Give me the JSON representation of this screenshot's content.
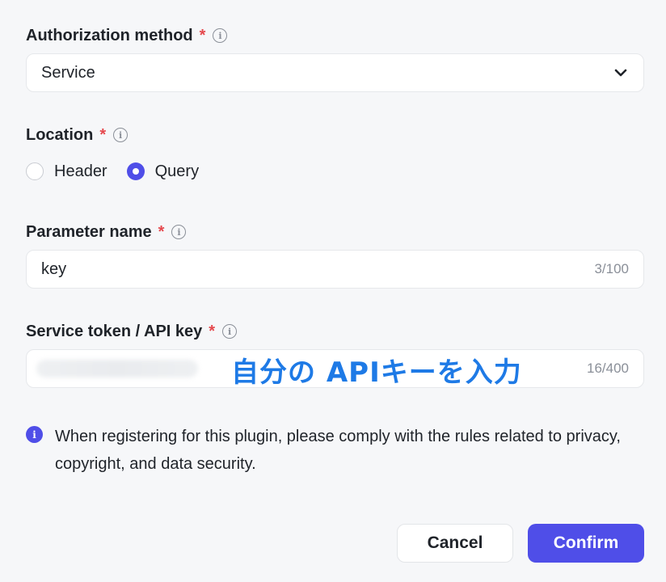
{
  "auth": {
    "label": "Authorization method",
    "required_mark": "*",
    "value": "Service"
  },
  "location": {
    "label": "Location",
    "required_mark": "*",
    "options": [
      {
        "label": "Header",
        "selected": false
      },
      {
        "label": "Query",
        "selected": true
      }
    ]
  },
  "param": {
    "label": "Parameter name",
    "required_mark": "*",
    "value": "key",
    "counter": "3/100"
  },
  "token": {
    "label": "Service token / API key",
    "required_mark": "*",
    "counter": "16/400",
    "overlay": "自分の APIキーを入力"
  },
  "notice": {
    "text": "When registering for this plugin, please comply with the rules related to privacy, copyright, and data security."
  },
  "buttons": {
    "cancel": "Cancel",
    "confirm": "Confirm"
  },
  "colors": {
    "accent": "#4f4ee8",
    "required": "#e5484d",
    "overlay": "#1e7ae6"
  },
  "icons": {
    "info": "info-icon",
    "dropdown": "chevron-down-icon"
  }
}
